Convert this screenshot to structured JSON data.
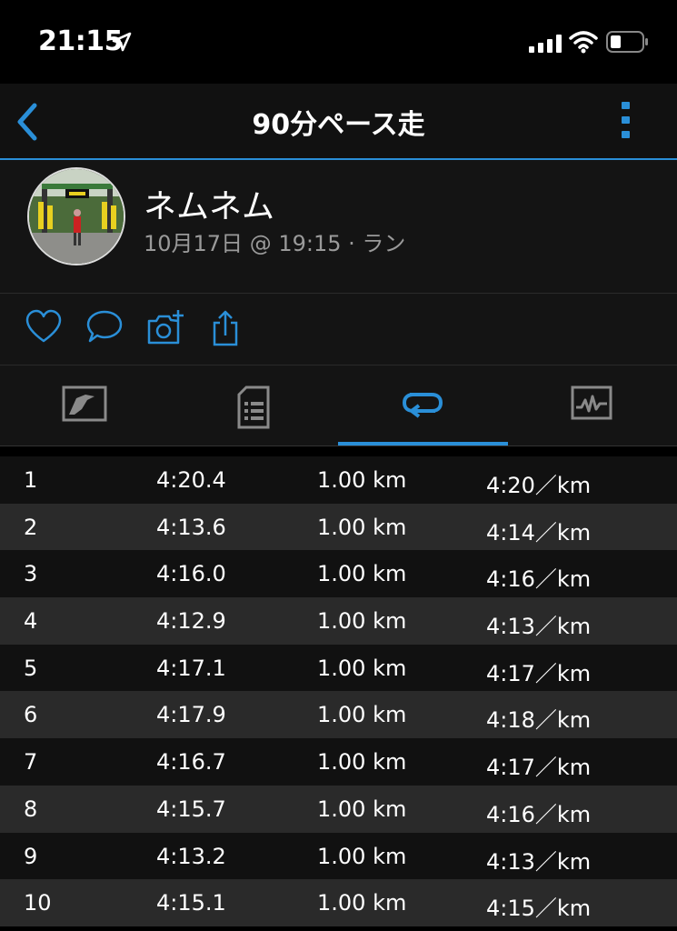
{
  "status_bar": {
    "time": "21:15"
  },
  "nav": {
    "title": "90分ペース走"
  },
  "profile": {
    "name": "ネムネム",
    "meta": "10月17日 @ 19:15 · ラン"
  },
  "colors": {
    "accent": "#2a8fd8",
    "background": "#000000",
    "row_dark": "#111111",
    "row_light": "#2a2a2a"
  },
  "actions": [
    "heart-icon",
    "comment-icon",
    "camera-add-icon",
    "share-icon"
  ],
  "tabs": [
    "map-tab",
    "details-tab",
    "laps-tab",
    "charts-tab"
  ],
  "active_tab": "laps-tab",
  "laps": [
    {
      "num": "1",
      "time": "4:20.4",
      "dist": "1.00 km",
      "pace": "4:20／km"
    },
    {
      "num": "2",
      "time": "4:13.6",
      "dist": "1.00 km",
      "pace": "4:14／km"
    },
    {
      "num": "3",
      "time": "4:16.0",
      "dist": "1.00 km",
      "pace": "4:16／km"
    },
    {
      "num": "4",
      "time": "4:12.9",
      "dist": "1.00 km",
      "pace": "4:13／km"
    },
    {
      "num": "5",
      "time": "4:17.1",
      "dist": "1.00 km",
      "pace": "4:17／km"
    },
    {
      "num": "6",
      "time": "4:17.9",
      "dist": "1.00 km",
      "pace": "4:18／km"
    },
    {
      "num": "7",
      "time": "4:16.7",
      "dist": "1.00 km",
      "pace": "4:17／km"
    },
    {
      "num": "8",
      "time": "4:15.7",
      "dist": "1.00 km",
      "pace": "4:16／km"
    },
    {
      "num": "9",
      "time": "4:13.2",
      "dist": "1.00 km",
      "pace": "4:13／km"
    },
    {
      "num": "10",
      "time": "4:15.1",
      "dist": "1.00 km",
      "pace": "4:15／km"
    }
  ]
}
